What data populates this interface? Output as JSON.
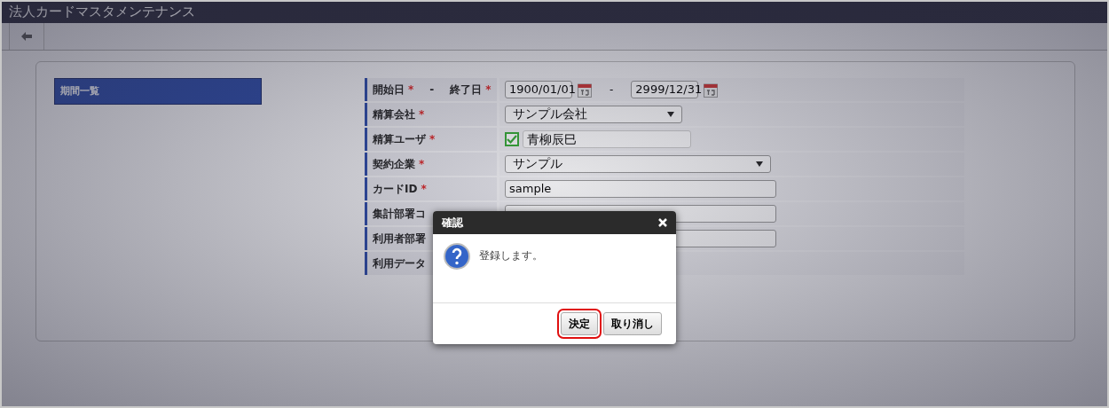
{
  "title": "法人カードマスタメンテナンス",
  "sidebar": {
    "items": [
      {
        "label": "期間一覧",
        "selected": true
      }
    ]
  },
  "form": {
    "rows": [
      {
        "kind": "daterange",
        "label": "開始日",
        "required_mark": "*",
        "separator": "-",
        "label_2": "終了日",
        "required_mark_2": "*",
        "start": "1900/01/01",
        "range_separator": "-",
        "end": "2999/12/31"
      },
      {
        "kind": "select",
        "label": "精算会社",
        "required_mark": "*",
        "value": "サンプル会社"
      },
      {
        "kind": "user",
        "label": "精算ユーザ",
        "required_mark": "*",
        "checked": true,
        "value": "青柳辰巳"
      },
      {
        "kind": "wideselect",
        "label": "契約企業",
        "required_mark": "*",
        "value": "サンプル"
      },
      {
        "kind": "text",
        "label": "カードID",
        "required_mark": "*",
        "value": "sample"
      },
      {
        "kind": "text",
        "label": "集計部署コ"
      },
      {
        "kind": "text",
        "label": "利用者部署"
      },
      {
        "kind": "empty",
        "label": "利用データ"
      }
    ]
  },
  "dialog": {
    "title": "確認",
    "message": "登録します。",
    "buttons": [
      {
        "label": "決定",
        "highlighted": true
      },
      {
        "label": "取り消し",
        "highlighted": false
      }
    ]
  }
}
